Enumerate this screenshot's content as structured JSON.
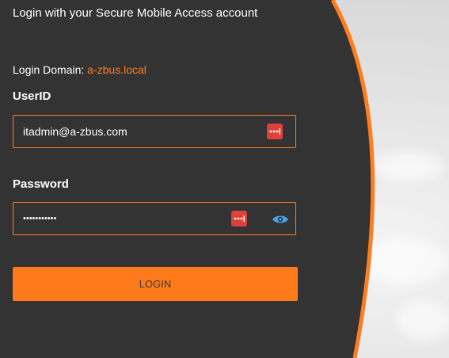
{
  "header": {
    "subtitle": "Login with your Secure Mobile Access account"
  },
  "domain": {
    "label": "Login Domain: ",
    "value": "a-zbus.local"
  },
  "userid": {
    "label": "UserID",
    "value": "itadmin@a-zbus.com"
  },
  "password": {
    "label": "Password",
    "value": "•••••••••••"
  },
  "login": {
    "label": "LOGIN"
  },
  "colors": {
    "accent": "#ff7d1f",
    "panel": "#333333",
    "password_manager_icon": "#e0403a",
    "eye_icon": "#4aa3e8"
  },
  "icons": {
    "password_manager": "password-manager-icon",
    "show_password": "eye-icon"
  }
}
